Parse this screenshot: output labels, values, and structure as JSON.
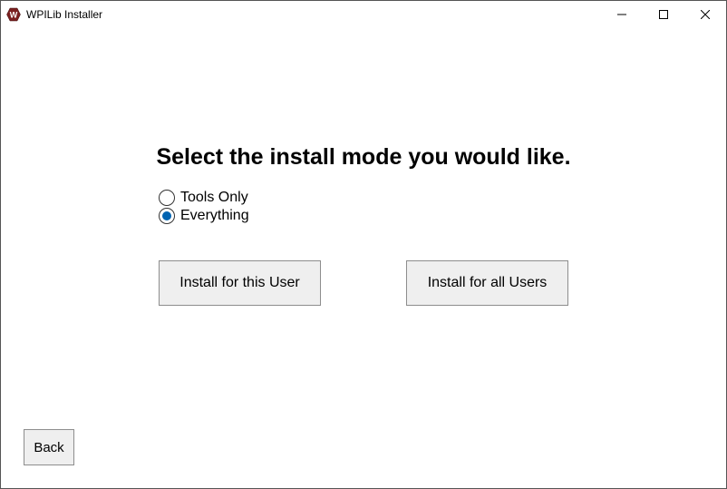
{
  "window": {
    "title": "WPILib Installer"
  },
  "heading": "Select the install mode you would like.",
  "options": [
    {
      "id": "tools-only",
      "label": "Tools Only",
      "selected": false
    },
    {
      "id": "everything",
      "label": "Everything",
      "selected": true
    }
  ],
  "buttons": {
    "install_this_user": "Install for this User",
    "install_all_users": "Install for all Users",
    "back": "Back"
  },
  "colors": {
    "accent": "#0063b1",
    "button_bg": "#efefef",
    "button_border": "#8d8d8d"
  }
}
